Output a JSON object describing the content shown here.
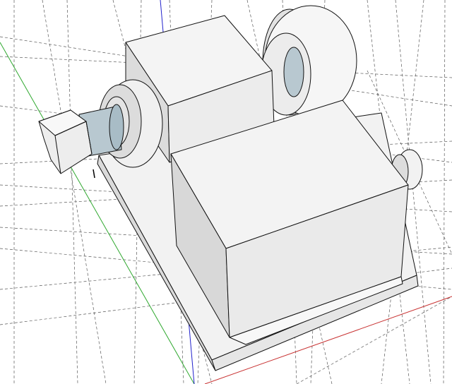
{
  "viewport": {
    "axis_colors": {
      "red": "#c83232",
      "green": "#2fa82f",
      "blue": "#2222cc"
    },
    "guide_color": "#222222",
    "face_colors": {
      "light": "#f4f4f4",
      "mid": "#e8e8e8",
      "dark": "#d8d8d8",
      "shaft": "#b8c8d0"
    }
  }
}
